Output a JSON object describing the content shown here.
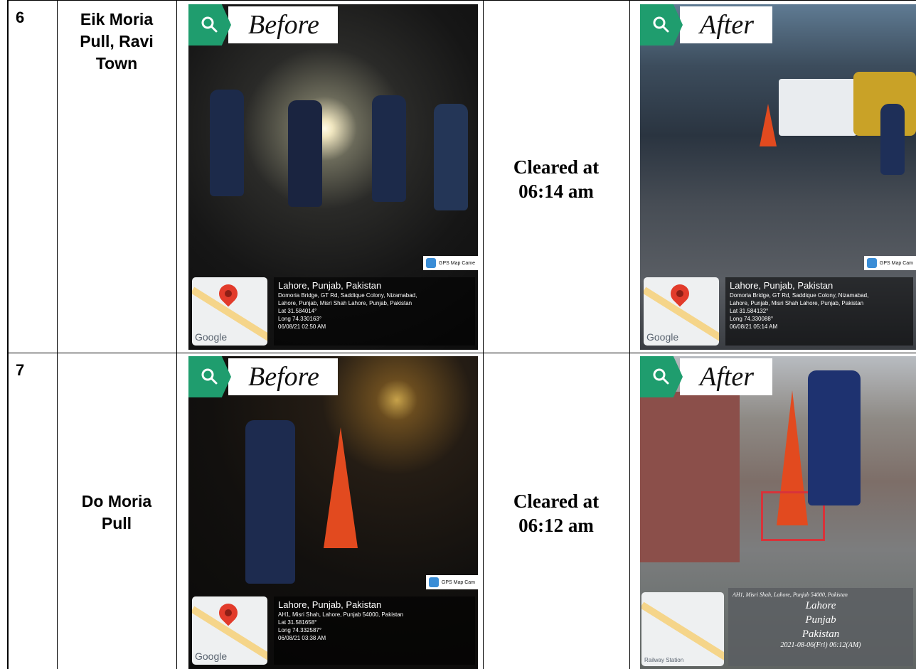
{
  "rows": [
    {
      "number": "6",
      "location_lines": [
        "Eik Moria",
        "Pull, Ravi",
        "Town"
      ],
      "status_lines": [
        "Cleared at",
        "06:14 am"
      ],
      "before": {
        "badge": "Before",
        "gps_brand": "GPS Map Came",
        "map_label": "Google",
        "city": "Lahore, Punjab, Pakistan",
        "lines": [
          "Domoria Bridge, GT Rd, Saddique Colony, Nizamabad,",
          "Lahore, Punjab, Misri Shah Lahore, Punjab, Pakistan",
          "Lat 31.584014°",
          "Long 74.330163°",
          "06/08/21 02:50 AM"
        ]
      },
      "after": {
        "badge": "After",
        "gps_brand": "GPS Map Cam",
        "map_label": "Google",
        "city": "Lahore, Punjab, Pakistan",
        "lines": [
          "Domoria Bridge, GT Rd, Saddique Colony, Nizamabad,",
          "Lahore, Punjab, Misri Shah Lahore, Punjab, Pakistan",
          "Lat 31.584132°",
          "Long 74.330088°",
          "06/08/21 05:14 AM"
        ]
      }
    },
    {
      "number": "7",
      "location_lines": [
        "Do Moria",
        "Pull"
      ],
      "status_lines": [
        "Cleared at",
        "06:12 am"
      ],
      "before": {
        "badge": "Before",
        "gps_brand": "GPS Map Cam",
        "map_label": "Google",
        "city": "Lahore, Punjab, Pakistan",
        "lines": [
          "AH1, Misri Shah, Lahore, Punjab 54000, Pakistan",
          "Lat 31.581658°",
          "Long 74.332587°",
          "06/08/21 03:38 AM"
        ]
      },
      "after": {
        "badge": "After",
        "map_label": "Railway Station",
        "address": "AH1, Misri Shah, Lahore, Punjab 54000, Pakistan",
        "hand_lines": [
          "Lahore",
          "Punjab",
          "Pakistan"
        ],
        "stamp": "2021-08-06(Fri) 06:12(AM)"
      }
    }
  ],
  "colors": {
    "badge_green": "#1f9d6e",
    "grid": "#000000"
  }
}
